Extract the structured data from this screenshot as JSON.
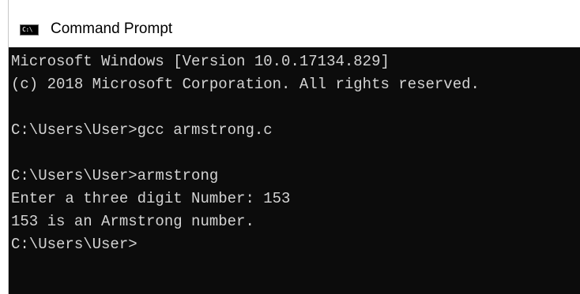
{
  "window": {
    "title": "Command Prompt",
    "icon": "cmd-icon",
    "icon_label": "C:\\"
  },
  "console": {
    "lines": [
      "Microsoft Windows [Version 10.0.17134.829]",
      "(c) 2018 Microsoft Corporation. All rights reserved.",
      "",
      "C:\\Users\\User>gcc armstrong.c",
      "",
      "C:\\Users\\User>armstrong",
      "Enter a three digit Number: 153",
      "153 is an Armstrong number.",
      "C:\\Users\\User>"
    ]
  },
  "colors": {
    "console_background": "#0c0c0c",
    "console_text": "#d4d4d4",
    "titlebar_background": "#ffffff"
  }
}
